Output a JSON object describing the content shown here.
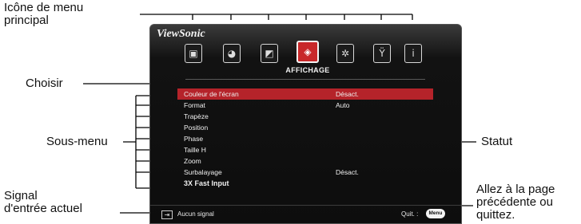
{
  "callouts": {
    "main_menu_icon": [
      "Icône de menu",
      "principal"
    ],
    "select": "Choisir",
    "submenu": "Sous-menu",
    "current_signal": [
      "Signal",
      "d'entrée actuel"
    ],
    "status": "Statut",
    "back_or_quit": [
      "Allez à la page",
      "précédente ou",
      "quittez."
    ]
  },
  "osd": {
    "brand": "ViewSonic",
    "menu_tabs": [
      {
        "icon": "monitor-icon",
        "glyph": "▣",
        "active": false
      },
      {
        "icon": "palette-icon",
        "glyph": "◕",
        "active": false
      },
      {
        "icon": "image-icon",
        "glyph": "◩",
        "active": false
      },
      {
        "icon": "display-icon",
        "glyph": "◈",
        "active": true
      },
      {
        "icon": "settings-gear-icon",
        "glyph": "✲",
        "active": false
      },
      {
        "icon": "tools-icon",
        "glyph": "Ÿ",
        "active": false
      },
      {
        "icon": "info-icon",
        "glyph": "i",
        "active": false
      }
    ],
    "active_title": "AFFICHAGE",
    "items": [
      {
        "label": "Couleur de l'écran",
        "value": "Désact.",
        "selected": true
      },
      {
        "label": "Format",
        "value": "Auto"
      },
      {
        "label": "Trapèze",
        "value": ""
      },
      {
        "label": "Position",
        "value": ""
      },
      {
        "label": "Phase",
        "value": ""
      },
      {
        "label": "Taille H",
        "value": ""
      },
      {
        "label": "Zoom",
        "value": ""
      },
      {
        "label": "Surbalayage",
        "value": "Désact."
      },
      {
        "label": "3X Fast Input",
        "value": "",
        "bold": true
      }
    ],
    "signal": "Aucun signal",
    "quit_label": "Quit. :",
    "menu_key": "Menu"
  },
  "colors": {
    "selected_row": "#b5232a",
    "active_tab": "#c8282a",
    "panel": "#121212"
  }
}
